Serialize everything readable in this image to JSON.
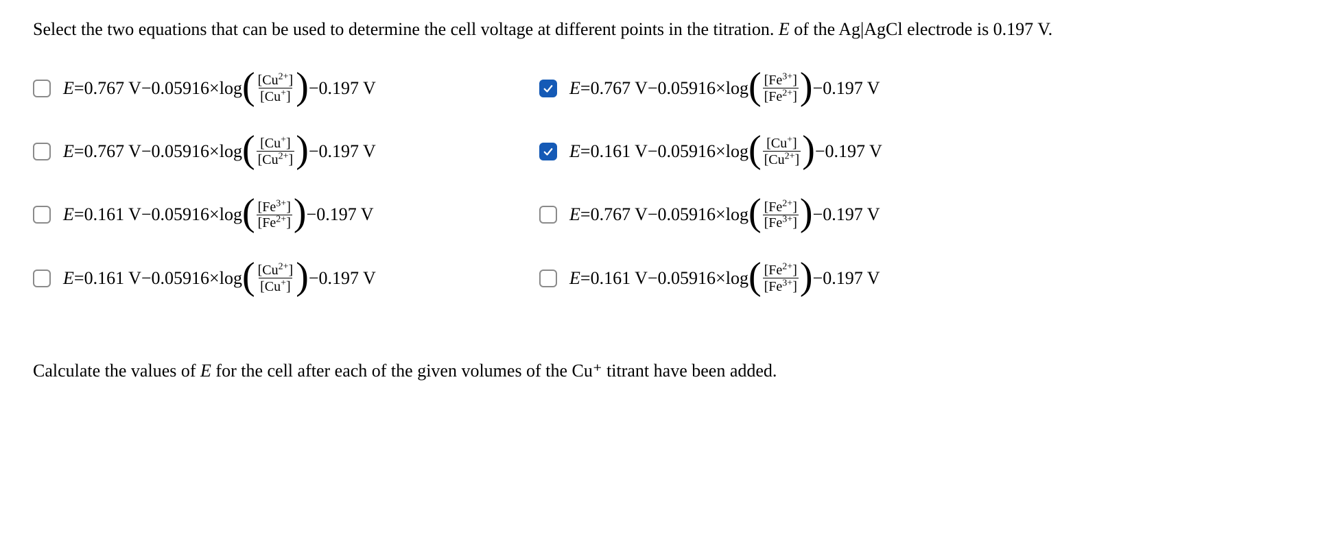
{
  "prompt_pre": "Select the two equations that can be used to determine the cell voltage at different points in the titration. ",
  "prompt_ital": "E",
  "prompt_mid": " of the Ag",
  "prompt_bar": "|",
  "prompt_after": "AgCl electrode is 0.197 V.",
  "const_0_05916": "0.05916",
  "log_text": "log",
  "minus": "−",
  "times": "×",
  "eq": "=",
  "E": "E",
  "ref_V": "0.197 V",
  "units_V": "V",
  "options": [
    {
      "checked": false,
      "E0": "0.767",
      "num": "[Cu²⁺]",
      "den": "[Cu⁺]"
    },
    {
      "checked": true,
      "E0": "0.767",
      "num": "[Fe³⁺]",
      "den": "[Fe²⁺]"
    },
    {
      "checked": false,
      "E0": "0.767",
      "num": "[Cu⁺]",
      "den": "[Cu²⁺]"
    },
    {
      "checked": true,
      "E0": "0.161",
      "num": "[Cu⁺]",
      "den": "[Cu²⁺]"
    },
    {
      "checked": false,
      "E0": "0.161",
      "num": "[Fe³⁺]",
      "den": "[Fe²⁺]"
    },
    {
      "checked": false,
      "E0": "0.767",
      "num": "[Fe²⁺]",
      "den": "[Fe³⁺]"
    },
    {
      "checked": false,
      "E0": "0.161",
      "num": "[Cu²⁺]",
      "den": "[Cu⁺]"
    },
    {
      "checked": false,
      "E0": "0.161",
      "num": "[Fe²⁺]",
      "den": "[Fe³⁺]"
    }
  ],
  "followup_pre": "Calculate the values of ",
  "followup_E": "E",
  "followup_mid": " for the cell after each of the given volumes of the Cu",
  "followup_sup": "⁺",
  "followup_post": " titrant have been added."
}
